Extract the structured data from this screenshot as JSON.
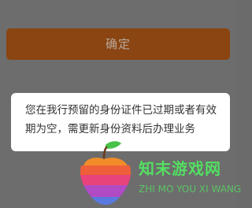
{
  "confirm_button": {
    "label": "确定"
  },
  "dialog": {
    "message": "您在我行预留的身份证件已过期或者有效期为空，需更新身份资料后办理业务"
  },
  "watermark": {
    "title": "知末游戏网",
    "subtitle": "ZHI MO YOU XI WANG"
  },
  "colors": {
    "overlay": "#6d6d6d",
    "button": "#8a4512",
    "button_text": "#b8a89b",
    "dialog_bg": "#ffffff",
    "watermark_green": "#55e063"
  },
  "icons": {
    "logo": "apple-logo-icon"
  }
}
